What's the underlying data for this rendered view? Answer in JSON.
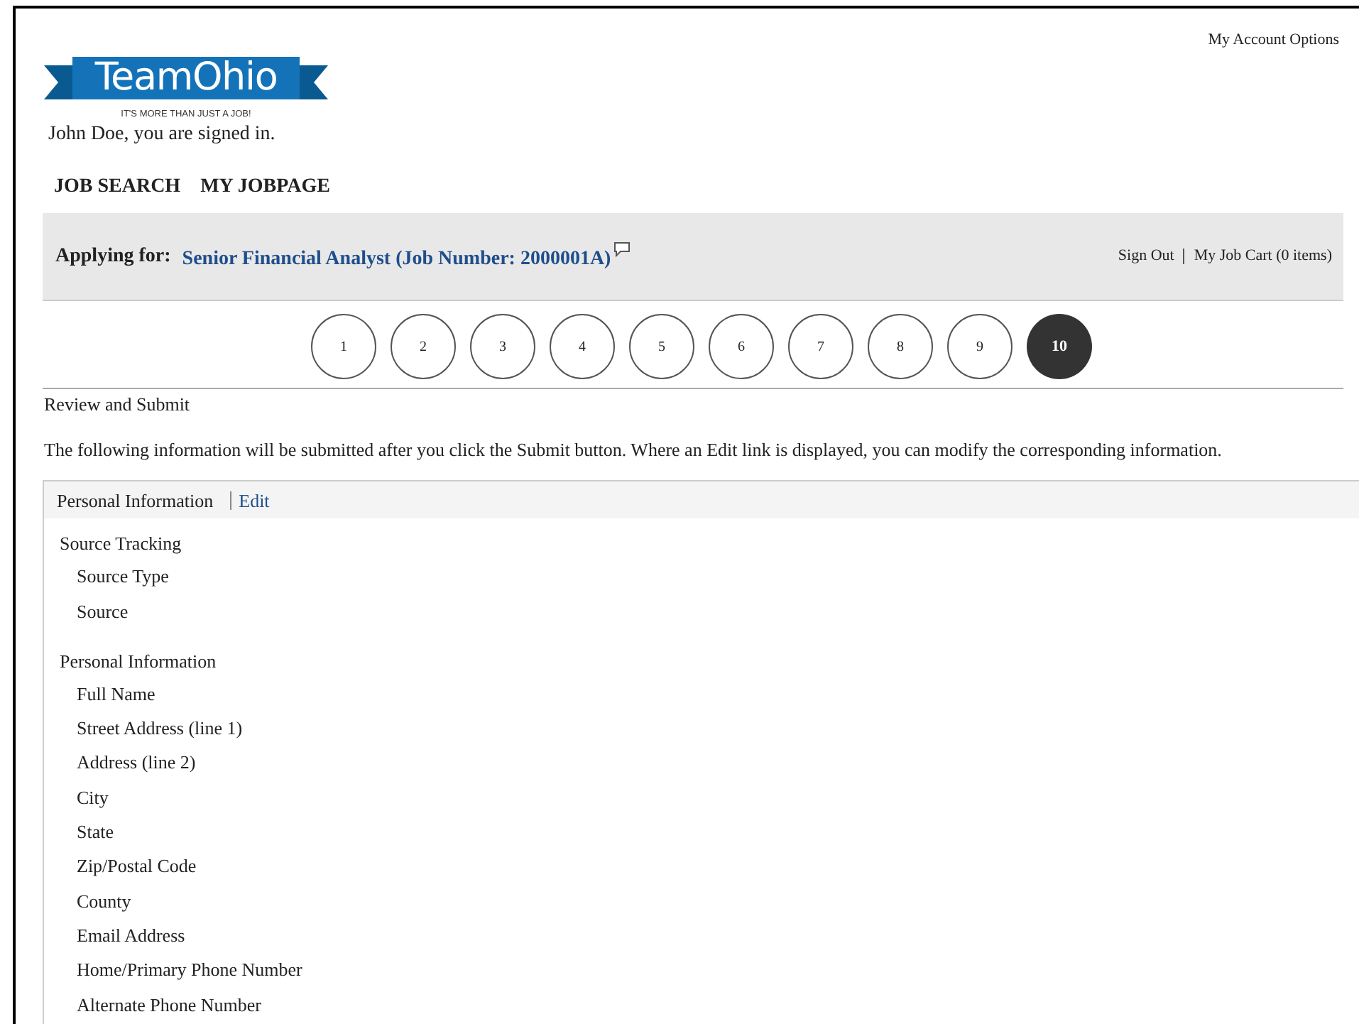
{
  "account_options": "My Account Options",
  "logo": {
    "title": "TeamOhio",
    "tagline": "IT'S MORE THAN JUST A JOB!"
  },
  "signed_in": "John Doe, you are signed in.",
  "nav": [
    "JOB SEARCH",
    "MY JOBPAGE"
  ],
  "applying": {
    "label": "Applying for:",
    "job": "Senior Financial Analyst (Job Number: 2000001A)"
  },
  "header_links": [
    "Sign Out",
    "My Job Cart (0 items)"
  ],
  "steps": [
    {
      "label": "1",
      "selected": false
    },
    {
      "label": "2",
      "selected": false
    },
    {
      "label": "3",
      "selected": false
    },
    {
      "label": "4",
      "selected": false
    },
    {
      "label": "5",
      "selected": false
    },
    {
      "label": "6",
      "selected": false
    },
    {
      "label": "7",
      "selected": false
    },
    {
      "label": "8",
      "selected": false
    },
    {
      "label": "9",
      "selected": false
    },
    {
      "label": "10",
      "selected": true
    }
  ],
  "page_title": "Review and Submit",
  "intro": "The following information will be submitted after you click the Submit button. Where an Edit link is displayed, you can modify the corresponding information.",
  "section": {
    "title": "Personal Information",
    "edit": "Edit",
    "groups": [
      {
        "title": "Source Tracking",
        "fields": [
          "Source Type",
          "Source"
        ]
      },
      {
        "title": "Personal Information",
        "fields": [
          "Full Name",
          "Street Address (line 1)",
          "Address (line 2)",
          "City",
          "State",
          "Zip/Postal Code",
          "County",
          "Email Address",
          "Home/Primary Phone Number",
          "Alternate Phone Number"
        ]
      }
    ]
  }
}
